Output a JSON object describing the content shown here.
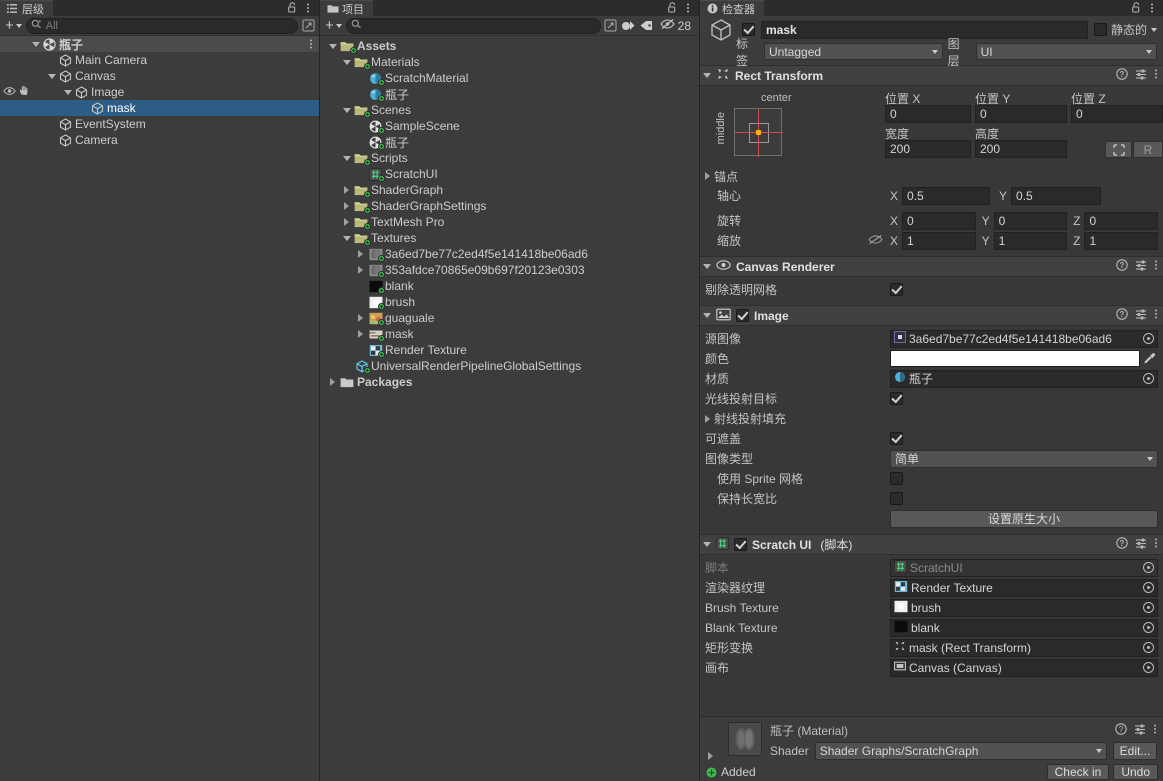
{
  "hierarchy": {
    "tab_label": "层级",
    "tab_icon": "hierarchy-icon",
    "search_placeholder": "All",
    "add_label": "+",
    "items": [
      {
        "label": "瓶子",
        "depth": 0,
        "twisty": "down",
        "icon": "scene-icon",
        "state": "root"
      },
      {
        "label": "Main Camera",
        "depth": 1,
        "twisty": "none",
        "icon": "gameobject-icon",
        "state": "normal"
      },
      {
        "label": "Canvas",
        "depth": 1,
        "twisty": "down",
        "icon": "gameobject-icon",
        "state": "normal"
      },
      {
        "label": "Image",
        "depth": 2,
        "twisty": "down",
        "icon": "gameobject-icon",
        "state": "hovered"
      },
      {
        "label": "mask",
        "depth": 3,
        "twisty": "none",
        "icon": "gameobject-icon",
        "state": "selected"
      },
      {
        "label": "EventSystem",
        "depth": 1,
        "twisty": "none",
        "icon": "gameobject-icon",
        "state": "normal"
      },
      {
        "label": "Camera",
        "depth": 1,
        "twisty": "none",
        "icon": "gameobject-icon",
        "state": "normal"
      }
    ]
  },
  "project": {
    "tab_label": "项目",
    "tab_icon": "folder-icon",
    "search_placeholder": "",
    "add_label": "+",
    "hidden_count": "28",
    "items": [
      {
        "label": "Assets",
        "depth": 0,
        "twisty": "down",
        "icon": "folder-vcs-icon",
        "bold": true
      },
      {
        "label": "Materials",
        "depth": 1,
        "twisty": "down",
        "icon": "folder-vcs-icon",
        "bold": false
      },
      {
        "label": "ScratchMaterial",
        "depth": 2,
        "twisty": "none",
        "icon": "material-icon",
        "bold": false
      },
      {
        "label": "瓶子",
        "depth": 2,
        "twisty": "none",
        "icon": "material-icon",
        "bold": false
      },
      {
        "label": "Scenes",
        "depth": 1,
        "twisty": "down",
        "icon": "folder-vcs-icon",
        "bold": false
      },
      {
        "label": "SampleScene",
        "depth": 2,
        "twisty": "none",
        "icon": "scene-asset-icon",
        "bold": false
      },
      {
        "label": "瓶子",
        "depth": 2,
        "twisty": "none",
        "icon": "scene-asset-icon",
        "bold": false
      },
      {
        "label": "Scripts",
        "depth": 1,
        "twisty": "down",
        "icon": "folder-vcs-icon",
        "bold": false
      },
      {
        "label": "ScratchUI",
        "depth": 2,
        "twisty": "none",
        "icon": "cs-script-icon",
        "bold": false
      },
      {
        "label": "ShaderGraph",
        "depth": 1,
        "twisty": "right",
        "icon": "folder-vcs-icon",
        "bold": false
      },
      {
        "label": "ShaderGraphSettings",
        "depth": 1,
        "twisty": "right",
        "icon": "folder-vcs-icon",
        "bold": false
      },
      {
        "label": "TextMesh Pro",
        "depth": 1,
        "twisty": "right",
        "icon": "folder-vcs-icon",
        "bold": false
      },
      {
        "label": "Textures",
        "depth": 1,
        "twisty": "down",
        "icon": "folder-vcs-icon",
        "bold": false
      },
      {
        "label": "3a6ed7be77c2ed4f5e141418be06ad6",
        "depth": 2,
        "twisty": "right",
        "icon": "texture-gray-icon",
        "bold": false
      },
      {
        "label": "353afdce70865e09b697f20123e0303",
        "depth": 2,
        "twisty": "right",
        "icon": "texture-gray-icon",
        "bold": false
      },
      {
        "label": "blank",
        "depth": 2,
        "twisty": "none",
        "icon": "texture-black-icon",
        "bold": false
      },
      {
        "label": "brush",
        "depth": 2,
        "twisty": "none",
        "icon": "texture-white-icon",
        "bold": false
      },
      {
        "label": "guaguale",
        "depth": 2,
        "twisty": "right",
        "icon": "texture-color-icon",
        "bold": false
      },
      {
        "label": "mask",
        "depth": 2,
        "twisty": "right",
        "icon": "texture-mask-icon",
        "bold": false
      },
      {
        "label": "Render Texture",
        "depth": 2,
        "twisty": "none",
        "icon": "render-texture-icon",
        "bold": false
      },
      {
        "label": "UniversalRenderPipelineGlobalSettings",
        "depth": 1,
        "twisty": "none",
        "icon": "settings-asset-icon",
        "bold": false
      },
      {
        "label": "Packages",
        "depth": 0,
        "twisty": "right",
        "icon": "folder-plain-icon",
        "bold": true
      }
    ]
  },
  "inspector": {
    "tab_label": "检查器",
    "tab_icon": "info-icon",
    "object": {
      "enabled": true,
      "name": "mask",
      "static_label": "静态的",
      "static_checked": false,
      "tag_label": "标签",
      "tag_value": "Untagged",
      "layer_label": "图层",
      "layer_value": "UI"
    },
    "rect_transform": {
      "title": "Rect Transform",
      "anchor_preset_h": "center",
      "anchor_preset_v": "middle",
      "pos_x_label": "位置 X",
      "pos_y_label": "位置 Y",
      "pos_z_label": "位置 Z",
      "pos_x": "0",
      "pos_y": "0",
      "pos_z": "0",
      "width_label": "宽度",
      "height_label": "高度",
      "width": "200",
      "height": "200",
      "blueprint_btn": "blueprint-mode",
      "raw_btn": "R",
      "anchors_label": "锚点",
      "pivot_label": "轴心",
      "pivot_x": "0.5",
      "pivot_y": "0.5",
      "rotation_label": "旋转",
      "rot_x": "0",
      "rot_y": "0",
      "rot_z": "0",
      "scale_label": "缩放",
      "scale_x": "1",
      "scale_y": "1",
      "scale_z": "1",
      "axis_x": "X",
      "axis_y": "Y",
      "axis_z": "Z"
    },
    "canvas_renderer": {
      "title": "Canvas Renderer",
      "cull_label": "剔除透明网格",
      "cull_checked": true
    },
    "image": {
      "title": "Image",
      "enabled": true,
      "source_label": "源图像",
      "source_value": "3a6ed7be77c2ed4f5e141418be06ad6",
      "color_label": "颜色",
      "color_value": "#FFFFFF",
      "material_label": "材质",
      "material_value": "瓶子",
      "raycast_target_label": "光线投射目标",
      "raycast_target_checked": true,
      "raycast_padding_label": "射线投射填充",
      "maskable_label": "可遮盖",
      "maskable_checked": true,
      "image_type_label": "图像类型",
      "image_type_value": "简单",
      "use_sprite_mesh_label": "使用 Sprite 网格",
      "use_sprite_mesh_checked": false,
      "preserve_aspect_label": "保持长宽比",
      "preserve_aspect_checked": false,
      "set_native_size_btn": "设置原生大小"
    },
    "scratch_ui": {
      "title": "Scratch UI",
      "title_suffix": "(脚本)",
      "enabled": true,
      "rows": [
        {
          "label": "脚本",
          "value": "ScratchUI",
          "icon": "cs-script-icon",
          "disabled": true
        },
        {
          "label": "渲染器纹理",
          "value": "Render Texture",
          "icon": "render-texture-icon",
          "disabled": false
        },
        {
          "label": "Brush Texture",
          "value": "brush",
          "icon": "texture-white-icon",
          "disabled": false
        },
        {
          "label": "Blank Texture",
          "value": "blank",
          "icon": "texture-black-icon",
          "disabled": false
        },
        {
          "label": "矩形变换",
          "value": "mask (Rect Transform)",
          "icon": "rect-transform-icon",
          "disabled": false
        },
        {
          "label": "画布",
          "value": "Canvas (Canvas)",
          "icon": "canvas-icon",
          "disabled": false
        }
      ]
    },
    "material_preview": {
      "title": "瓶子 (Material)",
      "shader_label": "Shader",
      "shader_value": "Shader Graphs/ScratchGraph",
      "edit_btn": "Edit..."
    },
    "vcs_bar": {
      "status": "Added",
      "checkin_btn": "Check in",
      "undo_btn": "Undo"
    }
  },
  "colors": {
    "selection_blue": "#2c5d87",
    "panel_bg": "#383838",
    "list_bg": "#3c3c3c",
    "header_bg": "#414141",
    "vcs_green": "#3fb950",
    "accent_orange": "#ffb400"
  }
}
